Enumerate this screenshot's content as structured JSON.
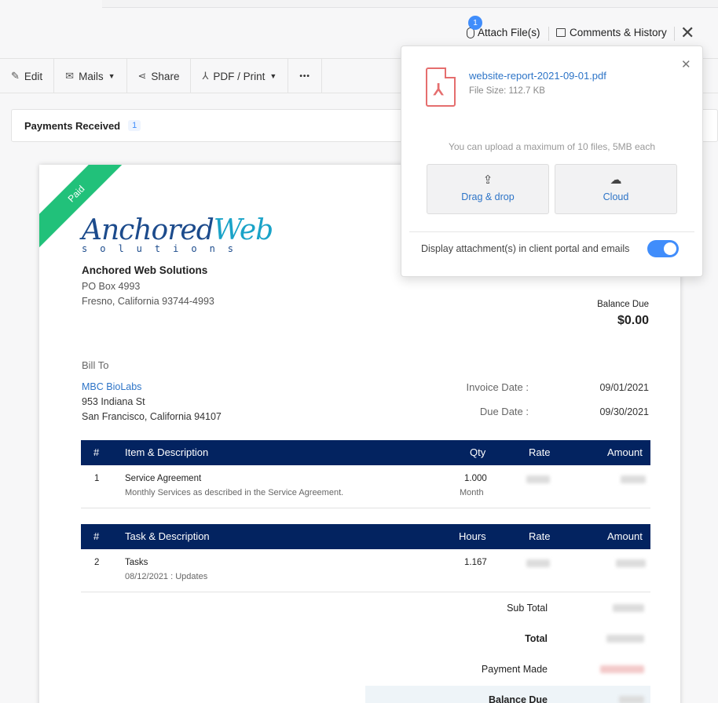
{
  "header": {
    "attach_label": "Attach File(s)",
    "attach_count": "1",
    "comments_label": "Comments & History"
  },
  "toolbar": {
    "edit_label": "Edit",
    "mails_label": "Mails",
    "share_label": "Share",
    "pdf_label": "PDF / Print",
    "more_label": "•••"
  },
  "payments": {
    "label": "Payments Received",
    "count": "1"
  },
  "invoice": {
    "status": "Paid",
    "logo_text": "Anchored",
    "logo_text2": "Web",
    "logo_sub": "solutions",
    "org_name": "Anchored Web Solutions",
    "org_address1": "PO Box 4993",
    "org_address2": "Fresno, California  93744-4993",
    "balance_label": "Balance Due",
    "balance_value": "$0.00",
    "bill_to_label": "Bill To",
    "client_name": "MBC BioLabs",
    "client_address1": "953 Indiana St",
    "client_address2": "San Francisco, California  94107",
    "invoice_date_label": "Invoice Date :",
    "invoice_date": "09/01/2021",
    "due_date_label": "Due Date :",
    "due_date": "09/30/2021",
    "items_header": {
      "num": "#",
      "desc": "Item & Description",
      "qty": "Qty",
      "rate": "Rate",
      "amount": "Amount"
    },
    "items": [
      {
        "num": "1",
        "name": "Service Agreement",
        "desc": "Monthly Services as described in the Service Agreement.",
        "qty": "1.000",
        "unit": "Month"
      }
    ],
    "tasks_header": {
      "num": "#",
      "desc": "Task & Description",
      "hours": "Hours",
      "rate": "Rate",
      "amount": "Amount"
    },
    "tasks": [
      {
        "num": "2",
        "name": "Tasks",
        "desc": "08/12/2021 : Updates",
        "hours": "1.167"
      }
    ],
    "subtotal_label": "Sub Total",
    "total_label": "Total",
    "payment_made_label": "Payment Made",
    "balance_due_label": "Balance Due"
  },
  "attach_popup": {
    "file_name": "website-report-2021-09-01.pdf",
    "file_size": "File Size: 112.7 KB",
    "limit_text": "You can upload a maximum of 10 files, 5MB each",
    "drag_label": "Drag & drop",
    "cloud_label": "Cloud",
    "display_text": "Display attachment(s) in client portal and emails",
    "toggle_on": true
  }
}
